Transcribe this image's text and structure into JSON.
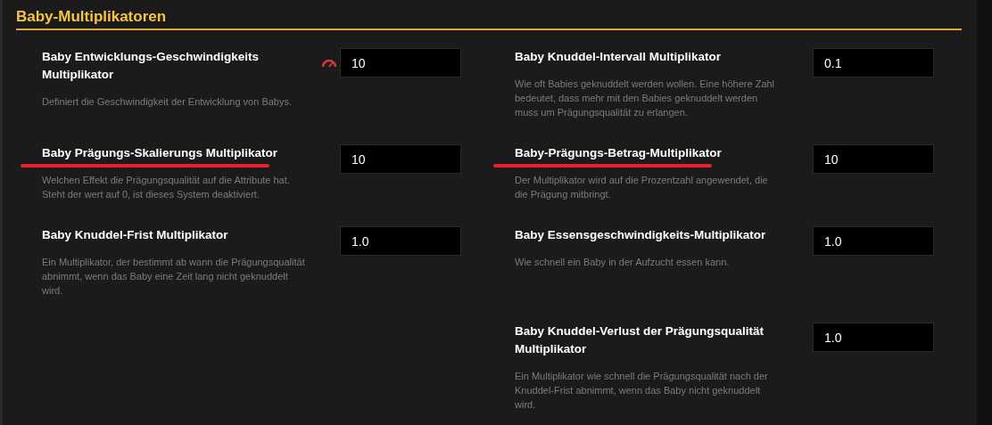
{
  "section": {
    "title": "Baby-Multiplikatoren"
  },
  "columns": [
    [
      {
        "label": "Baby Entwicklungs-Geschwindigkeits Multiplikator",
        "description": "Definiert die Geschwindigkeit der Entwicklung von Babys.",
        "value": "10",
        "underlined": false,
        "warning": true
      },
      {
        "label": "Baby Prägungs-Skalierungs Multiplikator",
        "description": "Welchen Effekt die Prägungsqualität auf die Attribute hat. Steht der wert auf 0, ist dieses System deaktiviert.",
        "value": "10",
        "underlined": true,
        "warning": false
      },
      {
        "label": "Baby Knuddel-Frist Multiplikator",
        "description": "Ein Multiplikator, der bestimmt ab wann die Prägungsqualität abnimmt, wenn das Baby eine Zeit lang nicht geknuddelt wird.",
        "value": "1.0",
        "underlined": false,
        "warning": false
      }
    ],
    [
      {
        "label": "Baby Knuddel-Intervall Multiplikator",
        "description": "Wie oft Babies geknuddelt werden wollen. Eine höhere Zahl bedeutet, dass mehr mit den Babies geknuddelt werden muss um Prägungsqualität zu erlangen.",
        "value": "0.1",
        "underlined": false,
        "warning": false
      },
      {
        "label": "Baby-Prägungs-Betrag-Multiplikator",
        "description": "Der Multiplikator wird auf die Prozentzahl angewendet, die die Prägung mitbringt.",
        "value": "10",
        "underlined": true,
        "warning": false
      },
      {
        "label": "Baby Essensgeschwindigkeits-Multiplikator",
        "description": "Wie schnell ein Baby in der Aufzucht essen kann.",
        "value": "1.0",
        "underlined": false,
        "warning": false
      },
      {
        "label": "Baby Knuddel-Verlust der Prägungsqualität Multiplikator",
        "description": "Ein Multiplikator wie schnell die Prägungsqualität nach der Knuddel-Frist abnimmt, wenn das Baby nicht geknuddelt wird.",
        "value": "1.0",
        "underlined": false,
        "warning": false
      }
    ]
  ]
}
